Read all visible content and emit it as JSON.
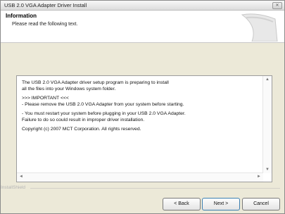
{
  "window": {
    "title": "USB 2.0 VGA Adapter Driver Install",
    "close_glyph": "✕"
  },
  "header": {
    "title": "Information",
    "subtitle": "Please read the following text."
  },
  "textbox": {
    "line1": "The USB 2.0 VGA Adapter driver setup program is preparing to install",
    "line2": "all the files into your Windows system folder.",
    "line3": ">>> IMPORTANT <<<",
    "line4": "- Please remove the USB 2.0 VGA Adapter from your system before starting.",
    "line5": "- You must restart your system before plugging in your USB 2.0 VGA Adapter.",
    "line6": "Failure to do so could result in improper driver installation.",
    "line7": "Copyright (c) 2007 MCT Corporation. All rights reserved.",
    "scroll_up": "▲",
    "scroll_down": "▼",
    "scroll_left": "◄",
    "scroll_right": "►"
  },
  "footer": {
    "brand": "InstallShield"
  },
  "buttons": {
    "back": "< Back",
    "next": "Next >",
    "cancel": "Cancel"
  }
}
